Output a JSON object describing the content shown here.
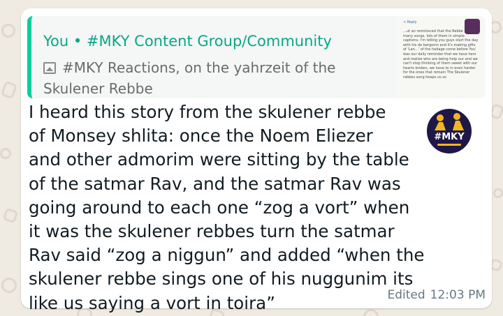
{
  "colors": {
    "wallpaper": "#efeae2",
    "quote_accent": "#06cf9c",
    "author_text": "#06a884",
    "meta_text": "#667781",
    "sticker_bg": "#1f1746",
    "sticker_gold": "#f1b722"
  },
  "quote": {
    "author": "You • #MKY Content Group/Community",
    "icon": "image-icon",
    "body": "#MKY Reactions, on the yahrzeit of the Skulener Rebbe"
  },
  "thumbnail": {
    "header": "< Reply",
    "text": "…ut an reminisced that the Rebbe poised many songs, lots of them in simple captions. I'm telling you guys start the day with his de bergonin and it's making gifts of 'Lan…' of the hadage come before You' was our daily reminder that we have hers and realize who are being help our and we can't stop thinking of them sweet with our hearts broken, we have to in even harder for the ones that remain The Skulener rebbes song heaps us so"
  },
  "message": {
    "text": "I heard this story from the skulener rebbe\nof Monsey shlita: once the Noem Eliezer\nand other admorim were sitting by the table\nof the satmar Rav, and the satmar Rav was\ngoing around to each one “zog a vort” when\nit was the skulener rebbes turn the satmar\nRav said “zog a niggun” and added “when the\nskulener rebbe sings one of his nuggunim its\nlike us saying a vort in toira”",
    "edited_label": "Edited",
    "time": "12:03 PM"
  },
  "sticker": {
    "icon": "mky-logo-sticker",
    "label": "#MKY"
  }
}
